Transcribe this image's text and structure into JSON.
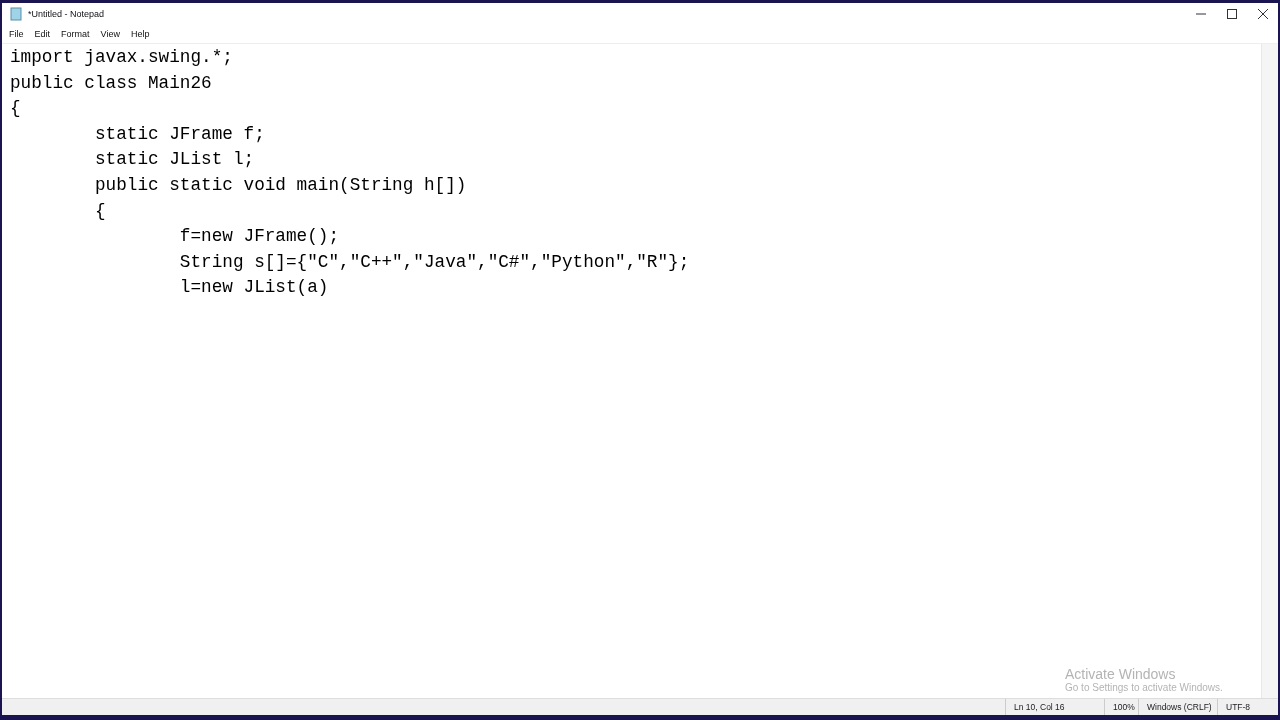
{
  "window": {
    "title": "*Untitled - Notepad"
  },
  "menu": [
    "File",
    "Edit",
    "Format",
    "View",
    "Help"
  ],
  "editor": {
    "lines": [
      "import javax.swing.*;",
      "public class Main26",
      "{",
      "\tstatic JFrame f;",
      "\tstatic JList l;",
      "\tpublic static void main(String h[])",
      "\t{",
      "\t\tf=new JFrame();",
      "\t\tString s[]={\"C\",\"C++\",\"Java\",\"C#\",\"Python\",\"R\"};",
      "\t\tl=new JList(a)"
    ]
  },
  "activation": {
    "title": "Activate Windows",
    "message": "Go to Settings to activate Windows."
  },
  "status_bar": [
    "Ln 10, Col 16",
    "100%",
    "Windows (CRLF)",
    "UTF-8"
  ]
}
